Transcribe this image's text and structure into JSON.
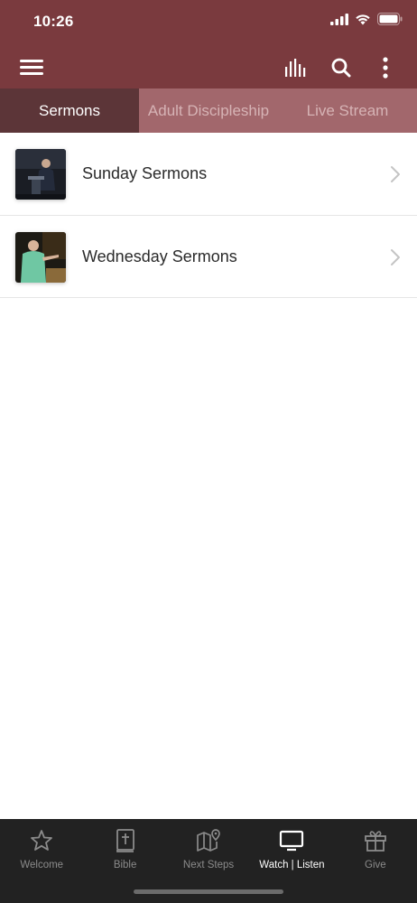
{
  "status_bar": {
    "time": "10:26"
  },
  "colors": {
    "header_bg": "#7a3a3e",
    "tab_bar_bg": "#a2676c",
    "tab_active_bg": "#5c3538",
    "bottom_bar_bg": "#222222"
  },
  "header": {
    "menu_icon": "hamburger-menu-icon",
    "audio_icon": "audio-bars-icon",
    "search_icon": "search-icon",
    "more_icon": "more-vertical-icon"
  },
  "tabs": [
    {
      "label": "Sermons",
      "active": true
    },
    {
      "label": "Adult Discipleship",
      "active": false
    },
    {
      "label": "Live Stream",
      "active": false
    }
  ],
  "list": [
    {
      "label": "Sunday Sermons",
      "thumb": "preacher-at-podium-photo"
    },
    {
      "label": "Wednesday Sermons",
      "thumb": "preacher-pointing-photo"
    }
  ],
  "bottom_nav": [
    {
      "label": "Welcome",
      "icon": "star-icon",
      "active": false
    },
    {
      "label": "Bible",
      "icon": "bible-icon",
      "active": false
    },
    {
      "label": "Next Steps",
      "icon": "map-pin-icon",
      "active": false
    },
    {
      "label": "Watch | Listen",
      "icon": "tv-icon",
      "active": true
    },
    {
      "label": "Give",
      "icon": "gift-icon",
      "active": false
    }
  ]
}
